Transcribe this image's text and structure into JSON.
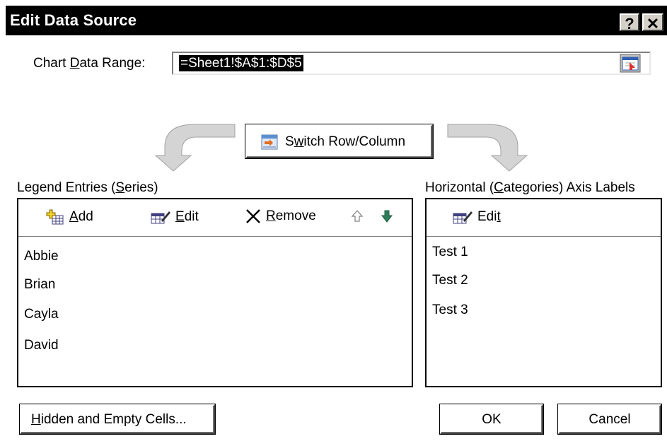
{
  "dialog": {
    "title": "Edit Data Source",
    "help_label": "?",
    "close_label": "✕"
  },
  "range": {
    "label_pre": "Chart ",
    "label_accel": "D",
    "label_post": "ata Range:",
    "value": "=Sheet1!$A$1:$D$5"
  },
  "switch": {
    "label_pre": "S",
    "label_accel": "w",
    "label_post": "itch Row/Column"
  },
  "legend": {
    "heading_pre": "Legend Entries (",
    "heading_accel": "S",
    "heading_post": "eries)",
    "add_accel": "A",
    "add_post": "dd",
    "edit_accel": "E",
    "edit_post": "dit",
    "remove_accel": "R",
    "remove_post": "emove",
    "items": [
      "Abbie",
      "Brian",
      "Cayla",
      "David"
    ]
  },
  "axis": {
    "heading_pre": "Horizontal (",
    "heading_accel": "C",
    "heading_post": "ategories) Axis Labels",
    "edit_pre": "Edi",
    "edit_accel": "t",
    "items": [
      "Test 1",
      "Test 2",
      "Test 3"
    ]
  },
  "footer": {
    "hidden_accel": "H",
    "hidden_post": "idden and Empty Cells...",
    "ok_label": "OK",
    "cancel_label": "Cancel"
  },
  "icons": {
    "help": "help-icon",
    "close": "close-icon",
    "collapse": "collapse-dialog-icon",
    "switch": "switch-row-column-icon",
    "add": "add-series-icon",
    "edit": "edit-icon",
    "remove": "remove-x-icon",
    "move_up": "arrow-up-outline-icon",
    "move_down": "arrow-down-green-icon",
    "left_curve": "curved-arrow-left-icon",
    "right_curve": "curved-arrow-right-icon"
  },
  "colors": {
    "titlebar": "#000000",
    "down_arrow": "#2e7d5b",
    "curve_arrow": "#d4d4d4"
  }
}
